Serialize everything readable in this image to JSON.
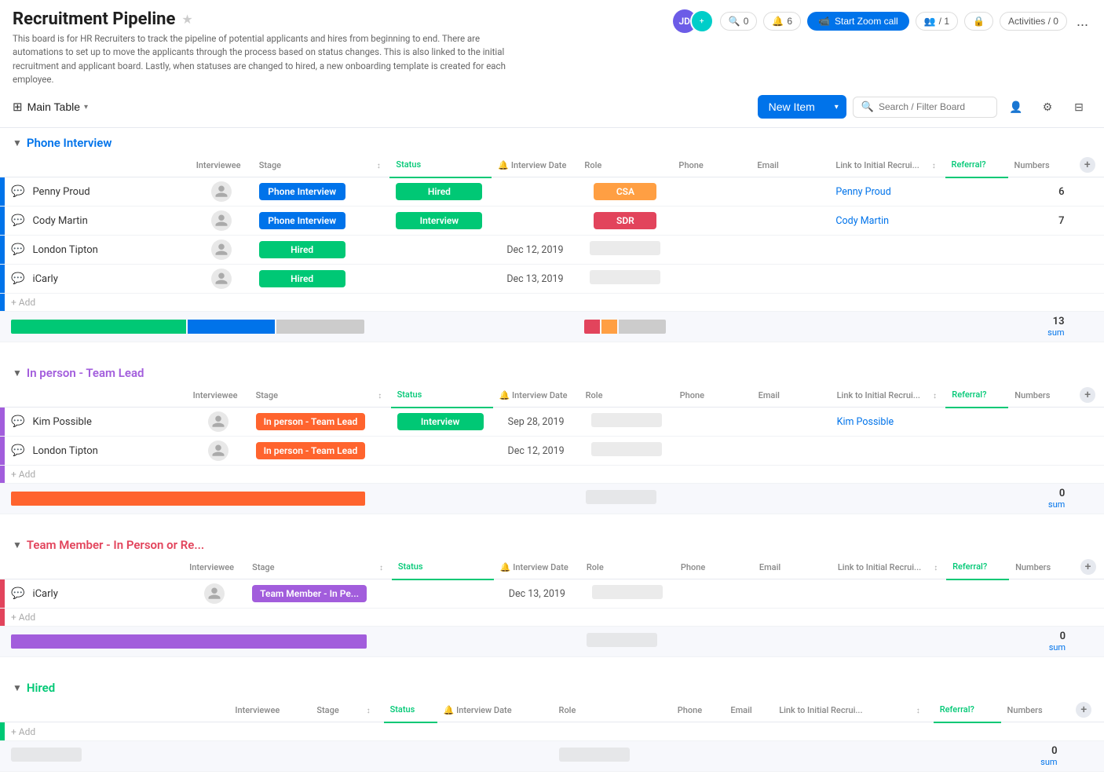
{
  "app": {
    "title": "Recruitment Pipeline",
    "description": "This board is for HR Recruiters to track the pipeline of potential applicants and hires from beginning to end. There are automations to set up to move the applicants through the process based on status changes. This is also linked to the initial recruitment and applicant board. Lastly, when statuses are changed to hired, a new onboarding template is created for each employee."
  },
  "header": {
    "avatar_initials": "JD",
    "conversations_count": "0",
    "updates_count": "6",
    "zoom_label": "Start Zoom call",
    "team_count": "1",
    "activities_label": "Activities / 0",
    "more": "..."
  },
  "toolbar": {
    "main_table_label": "Main Table",
    "new_item_label": "New Item",
    "search_placeholder": "Search / Filter Board"
  },
  "groups": [
    {
      "id": "phone-interview",
      "title": "Phone Interview",
      "color": "blue",
      "border_color": "#0073ea",
      "columns": [
        "Interviewee",
        "Stage",
        "",
        "Status",
        "Interview Date",
        "Role",
        "Phone",
        "Email",
        "Link to Initial Recrui...",
        "",
        "Referral?",
        "Numbers"
      ],
      "rows": [
        {
          "name": "Penny Proud",
          "stage": "Phone Interview",
          "stage_color": "#0073ea",
          "status": "Hired",
          "status_color": "#00c875",
          "interview_date": "",
          "role": "CSA",
          "role_color": "#ff9f43",
          "phone": "",
          "email": "",
          "link": "Penny Proud",
          "referral": "",
          "numbers": "6"
        },
        {
          "name": "Cody Martin",
          "stage": "Phone Interview",
          "stage_color": "#0073ea",
          "status": "Interview",
          "status_color": "#00c875",
          "interview_date": "",
          "role": "SDR",
          "role_color": "#e2445c",
          "phone": "",
          "email": "",
          "link": "Cody Martin",
          "referral": "",
          "numbers": "7"
        },
        {
          "name": "London Tipton",
          "stage": "Hired",
          "stage_color": "#00c875",
          "status": "",
          "status_color": "",
          "interview_date": "Dec 12, 2019",
          "role": "",
          "role_color": "",
          "phone": "",
          "email": "",
          "link": "",
          "referral": "",
          "numbers": ""
        },
        {
          "name": "iCarly",
          "stage": "Hired",
          "stage_color": "#00c875",
          "status": "",
          "status_color": "",
          "interview_date": "Dec 13, 2019",
          "role": "",
          "role_color": "",
          "phone": "",
          "email": "",
          "link": "",
          "referral": "",
          "numbers": ""
        }
      ],
      "summary_numbers": "13",
      "summary_label": "sum"
    },
    {
      "id": "in-person-team-lead",
      "title": "In person - Team Lead",
      "color": "purple",
      "border_color": "#a25ddc",
      "columns": [
        "Interviewee",
        "Stage",
        "",
        "Status",
        "Interview Date",
        "Role",
        "Phone",
        "Email",
        "Link to Initial Recrui...",
        "",
        "Referral?",
        "Numbers"
      ],
      "rows": [
        {
          "name": "Kim Possible",
          "stage": "In person - Team Lead",
          "stage_color": "#ff642e",
          "status": "Interview",
          "status_color": "#00c875",
          "interview_date": "Sep 28, 2019",
          "role": "",
          "role_color": "",
          "phone": "",
          "email": "",
          "link": "Kim Possible",
          "referral": "",
          "numbers": ""
        },
        {
          "name": "London Tipton",
          "stage": "In person - Team Lead",
          "stage_color": "#ff642e",
          "status": "",
          "status_color": "",
          "interview_date": "Dec 12, 2019",
          "role": "",
          "role_color": "",
          "phone": "",
          "email": "",
          "link": "",
          "referral": "",
          "numbers": ""
        }
      ],
      "summary_numbers": "0",
      "summary_label": "sum"
    },
    {
      "id": "team-member-in-person",
      "title": "Team Member - In Person or Re...",
      "color": "pink",
      "border_color": "#e2445c",
      "columns": [
        "Interviewee",
        "Stage",
        "",
        "Status",
        "Interview Date",
        "Role",
        "Phone",
        "Email",
        "Link to Initial Recrui...",
        "",
        "Referral?",
        "Numbers"
      ],
      "rows": [
        {
          "name": "iCarly",
          "stage": "Team Member - In Pe...",
          "stage_color": "#a25ddc",
          "status": "",
          "status_color": "",
          "interview_date": "Dec 13, 2019",
          "role": "",
          "role_color": "",
          "phone": "",
          "email": "",
          "link": "",
          "referral": "",
          "numbers": ""
        }
      ],
      "summary_numbers": "0",
      "summary_label": "sum"
    },
    {
      "id": "hired",
      "title": "Hired",
      "color": "green",
      "border_color": "#00c875",
      "columns": [
        "Interviewee",
        "Stage",
        "",
        "Status",
        "Interview Date",
        "Role",
        "Phone",
        "Email",
        "Link to Initial Recrui...",
        "",
        "Referral?",
        "Numbers"
      ],
      "rows": [],
      "summary_numbers": "0",
      "summary_label": "sum"
    }
  ],
  "labels": {
    "add": "+ Add",
    "sum": "sum"
  },
  "icons": {
    "search": "🔍",
    "person": "👤",
    "filter": "⊟",
    "grid": "⊞",
    "chat": "💬",
    "bell": "🔔",
    "sort": "↕",
    "plus": "+",
    "star": "★",
    "chevron_down": "▾",
    "chevron_right": "▶",
    "zoom": "📹"
  }
}
